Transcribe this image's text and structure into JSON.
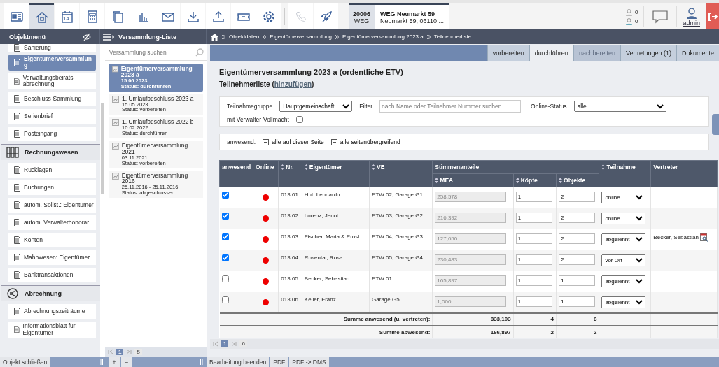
{
  "toolbar": {
    "tools": [
      {
        "selected": false,
        "disabled": false
      },
      {
        "selected": true,
        "disabled": false
      },
      {
        "selected": false,
        "disabled": false,
        "badge": "14"
      },
      {
        "selected": false,
        "disabled": false
      },
      {
        "selected": false,
        "disabled": false
      },
      {
        "selected": false,
        "disabled": false
      },
      {
        "selected": false,
        "disabled": false
      },
      {
        "selected": false,
        "disabled": false
      },
      {
        "selected": false,
        "disabled": false
      },
      {
        "selected": false,
        "disabled": false
      },
      {
        "selected": false,
        "disabled": false
      },
      {
        "selected": false,
        "disabled": true
      },
      {
        "selected": false,
        "disabled": false
      }
    ],
    "object": {
      "number": "20006",
      "type": "WEG",
      "name": "WEG Neumarkt 59",
      "address": "Neumarkt 59, 06110 ..."
    },
    "counters": [
      "0",
      "0"
    ],
    "user": "admin"
  },
  "header": {
    "menu_title": "Objektmenü",
    "list_title": "Versammlung-Liste",
    "breadcrumb": [
      "Objektdaten",
      "Eigentümerversammlung",
      "Eigentümerversammlung 2023 a",
      "Teilnehmerliste"
    ]
  },
  "sidebar": {
    "items": [
      {
        "kind": "item",
        "label": "Sanierung",
        "selected": false
      },
      {
        "kind": "item",
        "label": "Eigentümerversammlung",
        "selected": true
      },
      {
        "kind": "item",
        "label": "Verwaltungsbeirats-abrechnung",
        "selected": false
      },
      {
        "kind": "item",
        "label": "Beschluss-Sammlung",
        "selected": false
      },
      {
        "kind": "item",
        "label": "Serienbrief",
        "selected": false
      },
      {
        "kind": "item",
        "label": "Posteingang",
        "selected": false
      },
      {
        "kind": "section",
        "label": "Rechnungswesen"
      },
      {
        "kind": "item",
        "label": "Rücklagen",
        "selected": false
      },
      {
        "kind": "item",
        "label": "Buchungen",
        "selected": false
      },
      {
        "kind": "item",
        "label": "autom. Sollst.: Eigentümer",
        "selected": false
      },
      {
        "kind": "item",
        "label": "autom. Verwalterhonorar",
        "selected": false
      },
      {
        "kind": "item",
        "label": "Konten",
        "selected": false
      },
      {
        "kind": "item",
        "label": "Mahnwesen: Eigentümer",
        "selected": false
      },
      {
        "kind": "item",
        "label": "Banktransaktionen",
        "selected": false
      },
      {
        "kind": "section",
        "label": "Abrechnung"
      },
      {
        "kind": "item",
        "label": "Abrechnungszeiträume",
        "selected": false
      },
      {
        "kind": "item",
        "label": "Informationsblatt für Eigentümer",
        "selected": false
      }
    ]
  },
  "meetings": {
    "search": {
      "placeholder": "Versammlung suchen"
    },
    "items": [
      {
        "title": "Eigentümerversammlung 2023 a",
        "date": "15.06.2023",
        "status": "Status: durchführen",
        "selected": true
      },
      {
        "title": "1. Umlaufbeschluss 2023 a",
        "date": "15.05.2023",
        "status": "Status: vorbereiten",
        "selected": false
      },
      {
        "title": "1. Umlaufbeschluss 2022 b",
        "date": "10.02.2022",
        "status": "Status: durchführen",
        "selected": false
      },
      {
        "title": "Eigentümerversammlung 2021",
        "date": "03.11.2021",
        "status": "Status: vorbereiten",
        "selected": false
      },
      {
        "title": "Eigentümerversammlung 2016",
        "date": "25.11.2016 - 25.11.2016",
        "status": "Status: abgeschlossen",
        "selected": false
      }
    ],
    "pager": {
      "current": "1",
      "total": "5"
    }
  },
  "tabs": [
    {
      "label": "vorbereiten",
      "selected": false,
      "disabled": false
    },
    {
      "label": "durchführen",
      "selected": true,
      "disabled": false
    },
    {
      "label": "nachbereiten",
      "selected": false,
      "disabled": true
    },
    {
      "label": "Vertretungen (1)",
      "selected": false,
      "disabled": false
    },
    {
      "label": "Dokumente",
      "selected": false,
      "disabled": false
    }
  ],
  "content": {
    "title": "Eigentümerversammlung 2023 a (ordentliche ETV)",
    "subtitle_prefix": "Teilnehmerliste (",
    "add_link": "hinzufügen",
    "subtitle_suffix": ")",
    "filters": {
      "group_label": "Teilnahmegruppe",
      "group_value": "Hauptgemeinschaft",
      "filter_label": "Filter",
      "filter_placeholder": "nach Name oder Teilnehmer Nummer suchen",
      "online_label": "Online-Status",
      "online_value": "alle",
      "proxy_label": "mit Verwalter-Vollmacht",
      "proxy_checked": false
    },
    "presence": {
      "label": "anwesend:",
      "options": [
        "alle auf dieser Seite",
        "alle seitenübergreifend"
      ]
    },
    "table": {
      "columns": {
        "present": "anwesend",
        "online": "Online",
        "nr": "Nr.",
        "owner": "Eigentümer",
        "unit": "VE",
        "votes": "Stimmenanteile",
        "mea": "MEA",
        "heads": "Köpfe",
        "objects": "Objekte",
        "participation": "Teilnahme",
        "proxy": "Vertreter"
      },
      "rows": [
        {
          "present": true,
          "online": false,
          "nr": "013.01",
          "owner": "Hut, Leonardo",
          "unit": "ETW 02, Garage G1",
          "mea": "258,578",
          "heads": "1",
          "objects": "2",
          "participation": "online"
        },
        {
          "present": true,
          "online": false,
          "nr": "013.02",
          "owner": "Lorenz, Jenni",
          "unit": "ETW 03, Garage G2",
          "mea": "216,392",
          "heads": "1",
          "objects": "2",
          "participation": "online"
        },
        {
          "present": true,
          "online": false,
          "nr": "013.03",
          "owner": "Fischer, Maria & Ernst",
          "unit": "ETW 04, Garage G3",
          "mea": "127,650",
          "heads": "1",
          "objects": "2",
          "participation": "abgelehnt",
          "proxy": "Becker, Sebastian"
        },
        {
          "present": true,
          "online": false,
          "nr": "013.04",
          "owner": "Rosental, Rosa",
          "unit": "ETW 05, Garage G4",
          "mea": "230,483",
          "heads": "1",
          "objects": "2",
          "participation": "vor Ort"
        },
        {
          "present": false,
          "online": false,
          "nr": "013.05",
          "owner": "Becker, Sebastian",
          "unit": "ETW 01",
          "mea": "165,897",
          "heads": "1",
          "objects": "1",
          "participation": "abgelehnt"
        },
        {
          "present": false,
          "online": false,
          "nr": "013.06",
          "owner": "Keller, Franz",
          "unit": "Garage G5",
          "mea": "1,000",
          "heads": "1",
          "objects": "1",
          "participation": "abgelehnt"
        }
      ],
      "sums": [
        {
          "label": "Summe anwesend (u. vertreten):",
          "mea": "833,103",
          "heads": "4",
          "objects": "8"
        },
        {
          "label": "Summe abwesend:",
          "mea": "166,897",
          "heads": "2",
          "objects": "2"
        }
      ]
    },
    "pager": {
      "current": "1",
      "total": "6"
    }
  },
  "bottom": {
    "close": "Objekt schließen",
    "add": "+",
    "remove": "−",
    "buttons": [
      "Bearbeitung beenden",
      "PDF",
      "PDF -> DMS"
    ]
  }
}
